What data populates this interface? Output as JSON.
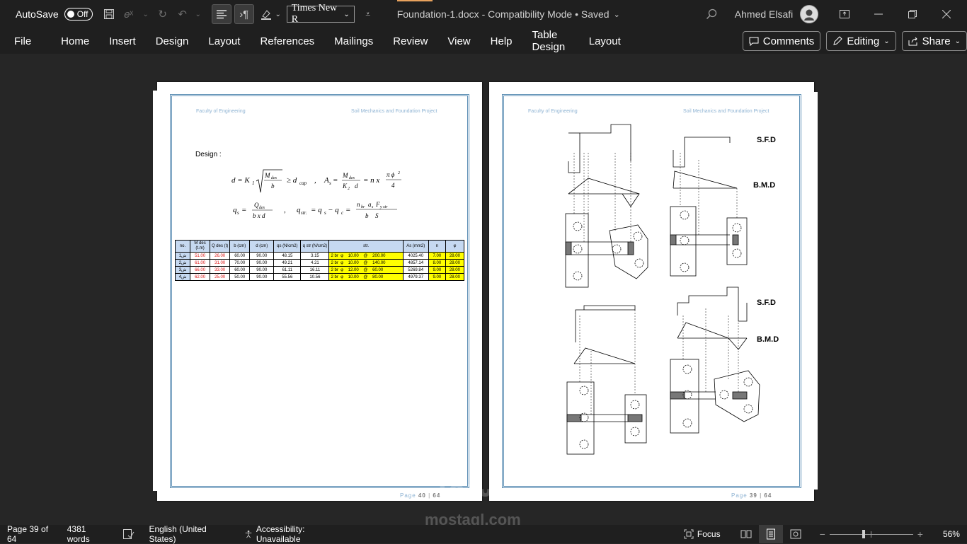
{
  "titlebar": {
    "autosave_label": "AutoSave",
    "autosave_state": "Off",
    "font_name": "Times New R",
    "doc_title": "Foundation-1.docx  -  Compatibility Mode • Saved",
    "user_name": "Ahmed Elsafi"
  },
  "menu": {
    "items": [
      "File",
      "Home",
      "Insert",
      "Design",
      "Layout",
      "References",
      "Mailings",
      "Review",
      "View",
      "Help",
      "Table Design",
      "Layout"
    ],
    "comments_label": "Comments",
    "editing_label": "Editing",
    "share_label": "Share"
  },
  "page_left": {
    "header_left": "Faculty of Engineering",
    "header_right": "Soil Mechanics and Foundation Project",
    "design_label": "Design :",
    "page_word": "Page",
    "page_number": "40",
    "page_total": "64",
    "table": {
      "headers": [
        "no.",
        "M des (t.m)",
        "Q des (t)",
        "b (cm)",
        "d (cm)",
        "qs (N/cm2)",
        "q str (N/cm2)",
        "str.",
        "As (mm2)",
        "n",
        "φ"
      ],
      "rows": [
        [
          "1ش",
          "51.00",
          "26.00",
          "60.00",
          "90.00",
          "48.15",
          "3.15",
          "2 br  φ    10.00    @    200.00",
          "4025.40",
          "7.00",
          "28.00"
        ],
        [
          "2ش",
          "61.00",
          "31.00",
          "70.00",
          "90.00",
          "49.21",
          "4.21",
          "2 br  φ    10.00    @    140.00",
          "4857.14",
          "8.00",
          "28.00"
        ],
        [
          "3ش",
          "66.00",
          "33.00",
          "60.00",
          "90.00",
          "61.11",
          "16.11",
          "2 br  φ    12.00    @    60.00",
          "5269.84",
          "9.00",
          "28.00"
        ],
        [
          "4ش",
          "62.00",
          "25.00",
          "50.00",
          "90.00",
          "55.56",
          "10.56",
          "2 br  φ    10.00    @    80.00",
          "4979.37",
          "9.00",
          "28.00"
        ]
      ]
    }
  },
  "page_right": {
    "header_left": "Faculty of Engineering",
    "header_right": "Soil Mechanics and Foundation Project",
    "labels": [
      "S.F.D",
      "B.M.D",
      "S.F.D",
      "B.M.D"
    ],
    "page_word": "Page",
    "page_number": "39",
    "page_total": "64"
  },
  "statusbar": {
    "page_info": "Page 39 of 64",
    "words": "4381 words",
    "language": "English (United States)",
    "accessibility": "Accessibility: Unavailable",
    "focus": "Focus",
    "zoom": "56%"
  },
  "watermark": {
    "arabic": "مستقل",
    "latin": "mostaql.com"
  }
}
